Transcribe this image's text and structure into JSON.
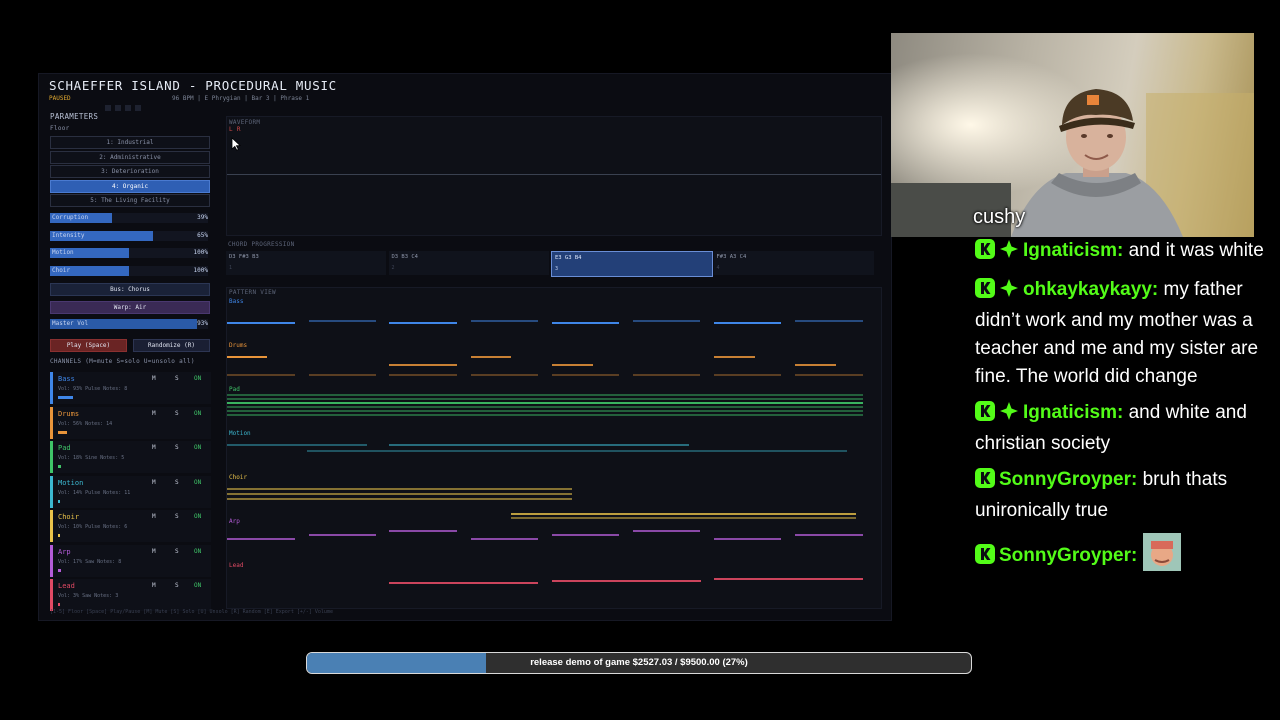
{
  "app": {
    "title": "SCHAEFFER ISLAND - PROCEDURAL MUSIC",
    "status": "PAUSED",
    "info": "96 BPM  |  E Phrygian  |  Bar 3  |  Phrase 1",
    "hint": "[1-5] Floor  [Space] Play/Pause  [M] Mute  [S] Solo  [U] Unsolo  [R] Random  [E] Export  [+/-] Volume"
  },
  "parameters": {
    "heading": "PARAMETERS",
    "floor_label": "Floor",
    "floors": [
      {
        "label": "1: Industrial",
        "active": false
      },
      {
        "label": "2: Administrative",
        "active": false
      },
      {
        "label": "3: Deterioration",
        "active": false
      },
      {
        "label": "4: Organic",
        "active": true
      },
      {
        "label": "5: The Living Facility",
        "active": false
      }
    ],
    "sliders": [
      {
        "name": "Corruption",
        "value": "39%",
        "level": 0.39
      },
      {
        "name": "Intensity",
        "value": "65%",
        "level": 0.65
      },
      {
        "name": "Motion",
        "value": "100%",
        "level": 0.5
      },
      {
        "name": "Choir",
        "value": "100%",
        "level": 0.5
      }
    ],
    "bus_button": "Bus: Chorus",
    "warp_button": "Warp: Air",
    "master": {
      "name": "Master Vol",
      "value": "93%",
      "level": 0.93
    },
    "play_button": "Play (Space)",
    "randomize_button": "Randomize (R)"
  },
  "channels": {
    "heading": "CHANNELS  (M=mute  S=solo  U=unsolo all)",
    "items": [
      {
        "name": "Bass",
        "info": "Vol: 93%  Pulse  Notes: 8",
        "color": "#3f86e8",
        "level": 0.93
      },
      {
        "name": "Drums",
        "info": "Vol: 56%  Notes: 14",
        "color": "#e8943a",
        "level": 0.56
      },
      {
        "name": "Pad",
        "info": "Vol: 18%  Sine  Notes: 5",
        "color": "#3fc468",
        "level": 0.18
      },
      {
        "name": "Motion",
        "info": "Vol: 14%  Pulse  Notes: 11",
        "color": "#3cb8d0",
        "level": 0.14
      },
      {
        "name": "Choir",
        "info": "Vol: 10%  Pulse  Notes: 6",
        "color": "#e8c24a",
        "level": 0.1
      },
      {
        "name": "Arp",
        "info": "Vol: 17%  Saw  Notes: 8",
        "color": "#b45cd8",
        "level": 0.17
      },
      {
        "name": "Lead",
        "info": "Vol: 3%  Saw  Notes: 3",
        "color": "#e04a64",
        "level": 0.03
      }
    ],
    "m_label": "M",
    "s_label": "S",
    "on_label": "ON"
  },
  "waveform": {
    "heading": "WAVEFORM",
    "lr": "L R"
  },
  "chord_progression": {
    "heading": "CHORD PROGRESSION",
    "chords": [
      {
        "notes": "D3 F#3 B3",
        "index": "1",
        "active": false
      },
      {
        "notes": "D3 B3 C4",
        "index": "2",
        "active": false
      },
      {
        "notes": "E3 G3 B4",
        "index": "3",
        "active": true
      },
      {
        "notes": "F#3 A3 C4",
        "index": "4",
        "active": false
      }
    ]
  },
  "pattern_view": {
    "heading": "PATTERN VIEW",
    "tracks": [
      {
        "name": "Bass",
        "color": "#3f86e8"
      },
      {
        "name": "Drums",
        "color": "#e8943a"
      },
      {
        "name": "Pad",
        "color": "#3fc468"
      },
      {
        "name": "Motion",
        "color": "#3cb8d0"
      },
      {
        "name": "Choir",
        "color": "#e8c24a"
      },
      {
        "name": "Arp",
        "color": "#b45cd8"
      },
      {
        "name": "Lead",
        "color": "#e04a64"
      }
    ]
  },
  "webcam": {
    "streamer": "cushy"
  },
  "chat": [
    {
      "user": "Ignaticism",
      "text": "and it was white",
      "verified": true
    },
    {
      "user": "ohkaykaykayy",
      "text": "my father didn’t work and my mother was a teacher and me and my sister are fine. The world did change",
      "verified": true
    },
    {
      "user": "Ignaticism",
      "text": "and white and christian society",
      "verified": true
    },
    {
      "user": "SonnyGroyper",
      "text": "bruh thats unironically true",
      "verified": false
    },
    {
      "user": "SonnyGroyper",
      "text": "",
      "verified": false,
      "emote": true
    }
  ],
  "chat_separator": ":",
  "donation_goal": {
    "text": "release demo of game $2527.03 / $9500.00 (27%)",
    "progress": 0.27,
    "color": "#4a80b4"
  }
}
